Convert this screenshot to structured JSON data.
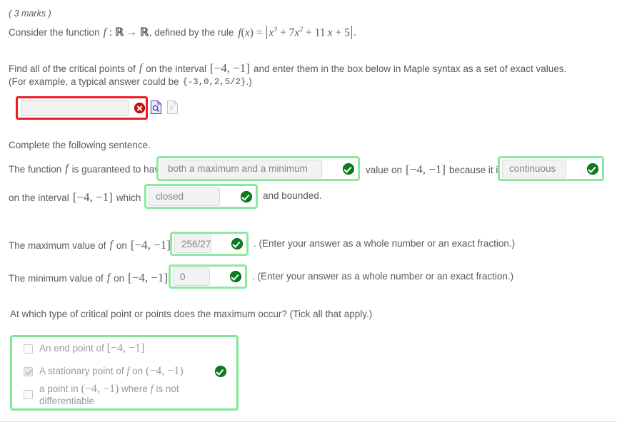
{
  "question": {
    "marks": "( 3 marks )",
    "intro_prefix": "Consider the function",
    "intro_mid": ", defined by the rule",
    "intro_suffix": ".",
    "f_symbol": "f",
    "map_arrow": "→",
    "reals": "ℝ",
    "rule_label": "f(x) =",
    "rule_expression": "|x^3 + 7x^2 + 11x + 5|",
    "instruction_line1": "Find all of the critical points of",
    "instruction_line1b": "on the interval",
    "instruction_line1c": "and enter them in the box below in Maple syntax as a set of exact values.",
    "interval_display": "[−4, −1]",
    "example_prefix": "(For example, a typical answer could be",
    "example_code": "{-3,0,2,5/2}",
    "example_suffix": ".)"
  },
  "answer_box": {
    "value": "",
    "placeholder": "",
    "status": "incorrect",
    "error_icon": "error-cross-icon",
    "preview_icon": "preview-document-icon",
    "plain_icon": "plain-text-document-icon"
  },
  "sentence": {
    "heading": "Complete the following sentence.",
    "line1_pre": "The function",
    "line1_f": "f",
    "line1_mid": "is guaranteed to have",
    "dropdown1_value": "both a maximum and a minimum",
    "line1_post": "value on",
    "line1_interval": "[−4, −1]",
    "line1_because": "because it is",
    "dropdown2_value": "continuous",
    "line2_pre": "on the interval",
    "line2_interval": "[−4, −1]",
    "line2_mid": "which is",
    "dropdown3_value": "closed",
    "line2_post": "and bounded."
  },
  "extrema": {
    "max_label_pre": "The maximum value of",
    "max_label_f": "f",
    "max_label_on": "on",
    "max_interval": "[−4, −1]",
    "max_label_is": "is",
    "max_value": "256/27",
    "max_hint": ". (Enter your answer as a whole number or an exact fraction.)",
    "min_label_pre": "The minimum value of",
    "min_label_f": "f",
    "min_label_on": "on",
    "min_interval": "[−4, −1]",
    "min_label_is": "is",
    "min_value": "0",
    "min_hint": ". (Enter your answer as a whole number or an exact fraction.)"
  },
  "critical_points": {
    "prompt": "At which type of critical point or points does the maximum occur? (Tick all that apply.)",
    "options": [
      {
        "text_pre": "An end point of",
        "interval": "[−4, −1]",
        "text_post": "",
        "checked": false
      },
      {
        "text_pre": "A stationary point of",
        "f": "f",
        "text_mid": "on",
        "interval": "(−4, −1)",
        "text_post": "",
        "checked": true
      },
      {
        "text_pre": "a point in",
        "interval": "(−4, −1)",
        "text_mid": "where",
        "f": "f",
        "text_post": "is not differentiable",
        "checked": false
      }
    ],
    "status": "correct"
  },
  "colors": {
    "error_border": "#ed1c24",
    "error_badge": "#cc1111",
    "success_border": "#8fe8a0",
    "success_badge": "#0a7d1f",
    "field_bg": "#f2f2f2",
    "text": "#595959"
  }
}
